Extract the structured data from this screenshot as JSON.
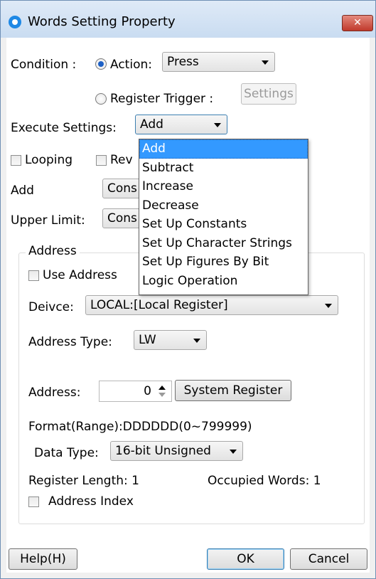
{
  "window": {
    "title": "Words Setting Property",
    "close_label": "✕"
  },
  "condition": {
    "label": "Condition :",
    "action_label": "Action:",
    "action_value": "Press",
    "register_trigger_label": "Register Trigger :",
    "settings_label": "Settings"
  },
  "execute": {
    "label": "Execute Settings:",
    "value": "Add"
  },
  "options": {
    "looping_label": "Looping",
    "rev_label": "Rev"
  },
  "add_row": {
    "label": "Add",
    "value": "Cons"
  },
  "upper_limit": {
    "label": "Upper Limit:",
    "value": "Cons"
  },
  "address": {
    "group_title": "Address",
    "use_address_label": "Use Address",
    "device_label": "Deivce:",
    "device_value": "LOCAL:[Local Register]",
    "address_type_label": "Address Type:",
    "address_type_value": "LW",
    "address_label": "Address:",
    "address_value": "0",
    "system_register_label": "System Register",
    "format_text": "Format(Range):DDDDDD(0~799999)",
    "data_type_label": "Data Type:",
    "data_type_value": "16-bit Unsigned",
    "register_length": "Register Length: 1",
    "occupied_words": "Occupied Words: 1",
    "address_index_label": "Address Index"
  },
  "dropdown_items": [
    "Add",
    "Subtract",
    "Increase",
    "Decrease",
    "Set Up Constants",
    "Set Up Character Strings",
    "Set Up Figures By Bit",
    "Logic Operation"
  ],
  "footer": {
    "help_label": "Help(H)",
    "ok_label": "OK",
    "cancel_label": "Cancel"
  }
}
